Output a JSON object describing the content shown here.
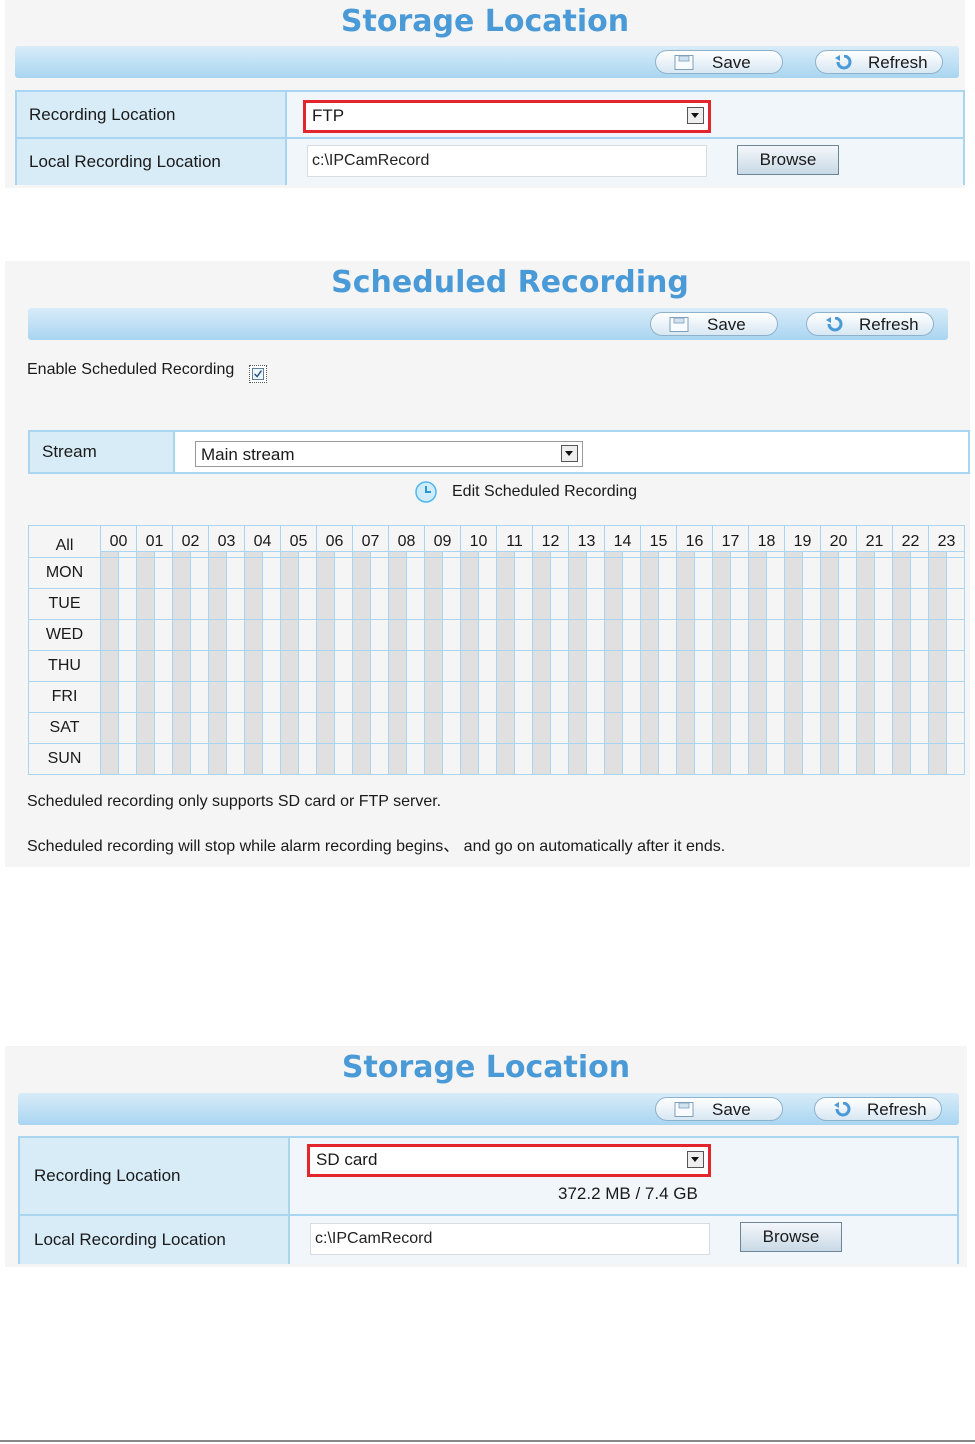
{
  "storage_top": {
    "title": "Storage Location",
    "save_label": "Save",
    "refresh_label": "Refresh",
    "recording_location_label": "Recording Location",
    "recording_location_value": "FTP",
    "local_recording_location_label": "Local Recording Location",
    "local_path_value": "c:\\IPCamRecord",
    "browse_label": "Browse"
  },
  "scheduled": {
    "title": "Scheduled Recording",
    "save_label": "Save",
    "refresh_label": "Refresh",
    "enable_label": "Enable Scheduled Recording",
    "enable_checked": true,
    "stream_label": "Stream",
    "stream_value": "Main stream",
    "edit_label": "Edit Scheduled Recording",
    "all_label": "All",
    "hours": [
      "00",
      "01",
      "02",
      "03",
      "04",
      "05",
      "06",
      "07",
      "08",
      "09",
      "10",
      "11",
      "12",
      "13",
      "14",
      "15",
      "16",
      "17",
      "18",
      "19",
      "20",
      "21",
      "22",
      "23"
    ],
    "days": [
      "MON",
      "TUE",
      "WED",
      "THU",
      "FRI",
      "SAT",
      "SUN"
    ],
    "note1": "Scheduled recording only supports SD card or FTP server.",
    "note2": "Scheduled recording will stop while alarm recording begins、 and go on automatically after it ends."
  },
  "storage_bottom": {
    "title": "Storage Location",
    "save_label": "Save",
    "refresh_label": "Refresh",
    "recording_location_label": "Recording Location",
    "recording_location_value": "SD card",
    "capacity": "372.2 MB / 7.4 GB",
    "local_recording_location_label": "Local Recording Location",
    "local_path_value": "c:\\IPCamRecord",
    "browse_label": "Browse"
  },
  "colors": {
    "title": "#4a9ad8",
    "toolbar": "#a9d5f1",
    "label_bg": "#d8ecf8",
    "highlight": "#e3262b"
  }
}
